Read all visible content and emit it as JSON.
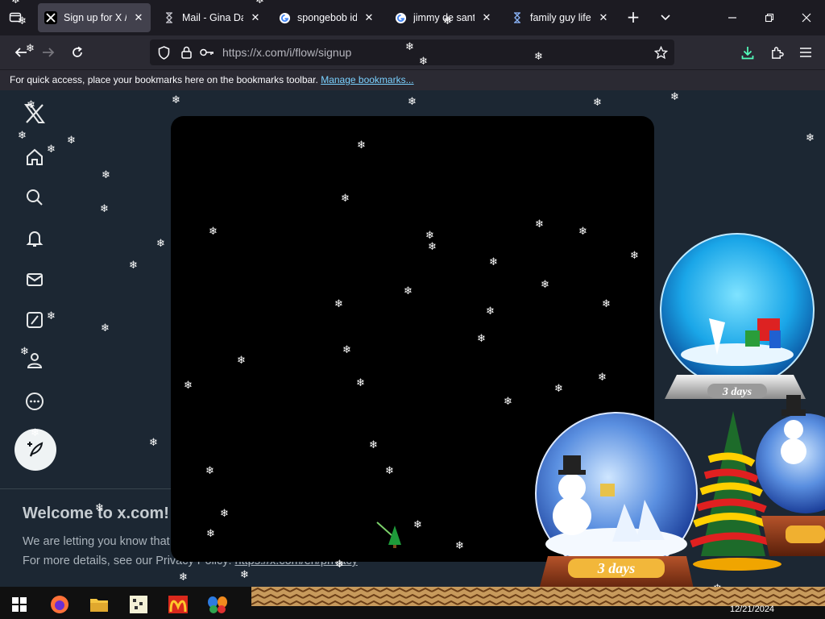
{
  "browser": {
    "tabs": [
      {
        "label": "Sign up for X / X",
        "favicon": "x-logo-icon",
        "active": true
      },
      {
        "label": "Mail - Gina Dab",
        "favicon": "hourglass-icon",
        "active": false
      },
      {
        "label": "spongebob id -",
        "favicon": "google-icon",
        "active": false
      },
      {
        "label": "jimmy de santa",
        "favicon": "google-icon",
        "active": false
      },
      {
        "label": "family guy life o",
        "favicon": "hourglass-icon",
        "active": false
      }
    ],
    "new_tab_label": "+",
    "address": "https://x.com/i/flow/signup",
    "bookmarks_message": "For quick access, place your bookmarks here on the bookmarks toolbar.",
    "bookmarks_link": "Manage bookmarks..."
  },
  "page": {
    "sidebar": [
      "x-logo-icon",
      "home-icon",
      "search-icon",
      "bell-icon",
      "mail-icon",
      "grok-icon",
      "profile-icon",
      "more-icon"
    ],
    "welcome_title": "Welcome to x.com!",
    "notice_line1": "We are letting you know that",
    "notice_line2_prefix": "For more details, see our Privacy Policy: ",
    "privacy_link": "https://x.com/en/privacy"
  },
  "decorations": {
    "globe_badge": "3 days",
    "globe_badge_large": "3 days"
  },
  "taskbar": {
    "icons": [
      "windows-start-icon",
      "firefox-icon",
      "file-explorer-icon",
      "pixel-game-icon",
      "mcdonalds-icon",
      "msn-butterfly-icon"
    ],
    "date": "12/21/2024"
  },
  "colors": {
    "page_bg": "#1c2733",
    "modal_bg": "#000000",
    "link": "#7ad1ff",
    "tab_active": "#42414d"
  }
}
